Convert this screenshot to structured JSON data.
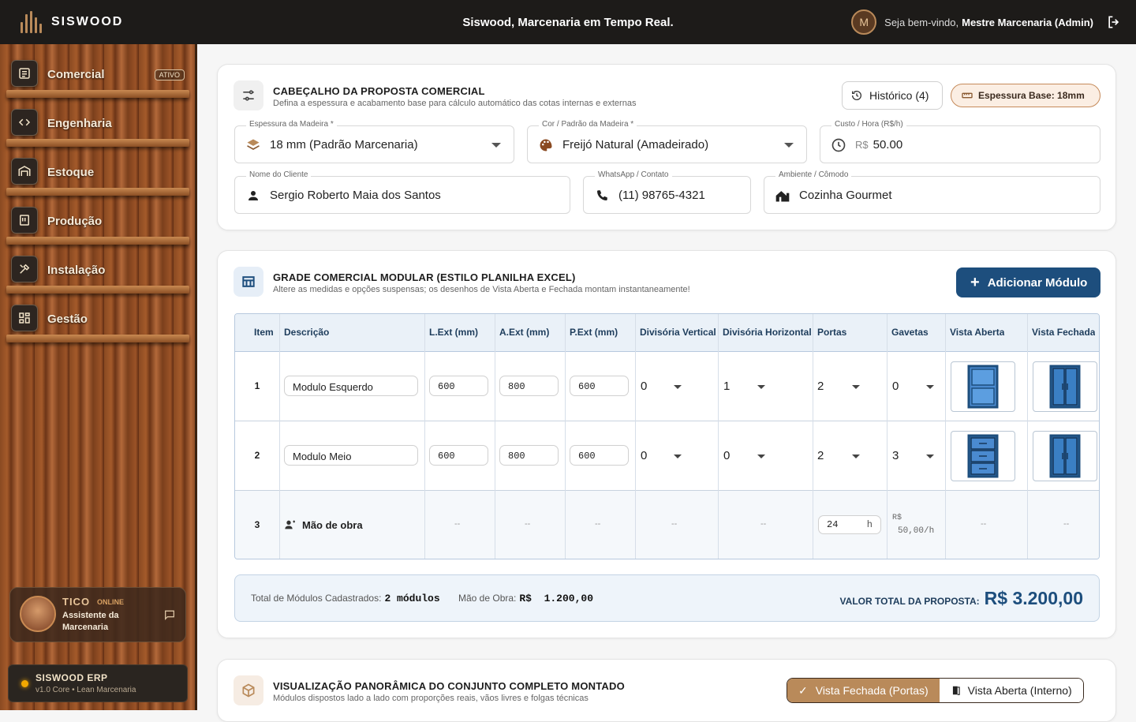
{
  "app": {
    "brand": "SISWOOD",
    "header_title": "Siswood, Marcenaria em Tempo Real.",
    "user_initial": "M",
    "welcome_prefix": "Seja bem-vindo,",
    "user_name": "Mestre Marcenaria (Admin)"
  },
  "sidebar": {
    "items": [
      {
        "label": "Comercial",
        "icon": "store-icon",
        "badge": "ATIVO"
      },
      {
        "label": "Engenharia",
        "icon": "code-icon"
      },
      {
        "label": "Estoque",
        "icon": "warehouse-icon"
      },
      {
        "label": "Produção",
        "icon": "production-icon"
      },
      {
        "label": "Instalação",
        "icon": "install-icon"
      },
      {
        "label": "Gestão",
        "icon": "dashboard-icon"
      }
    ],
    "assistant": {
      "name": "TICO",
      "status": "ONLINE",
      "subtitle": "Assistente da Marcenaria"
    },
    "erp": {
      "name": "SISWOOD ERP",
      "version": "v1.0 Core • Lean Marcenaria"
    }
  },
  "header_card": {
    "title": "CABEÇALHO DA PROPOSTA COMERCIAL",
    "subtitle": "Defina a espessura e acabamento base para cálculo automático das cotas internas e externas",
    "history_label": "Histórico (4)",
    "thickness_badge": "Espessura Base: 18mm",
    "fields": {
      "espessura": {
        "label": "Espessura da Madeira *",
        "value": "18 mm (Padrão Marcenaria)"
      },
      "cor": {
        "label": "Cor / Padrão da Madeira *",
        "value": "Freijó Natural (Amadeirado)"
      },
      "custo": {
        "label": "Custo / Hora (R$/h)",
        "prefix": "R$",
        "value": "50.00"
      },
      "cliente": {
        "label": "Nome do Cliente",
        "value": "Sergio Roberto Maia dos Santos"
      },
      "whatsapp": {
        "label": "WhatsApp / Contato",
        "value": "(11) 98765-4321"
      },
      "ambiente": {
        "label": "Ambiente / Cômodo",
        "value": "Cozinha Gourmet"
      }
    }
  },
  "grid_card": {
    "title": "GRADE COMERCIAL MODULAR (ESTILO PLANILHA EXCEL)",
    "subtitle": "Altere as medidas e opções suspensas; os desenhos de Vista Aberta e Fechada montam instantaneamente!",
    "add_button": "Adicionar Módulo",
    "columns": [
      "Item",
      "Descrição",
      "L.Ext (mm)",
      "A.Ext (mm)",
      "P.Ext (mm)",
      "Divisória Vertical",
      "Divisória Horizontal",
      "Portas",
      "Gavetas",
      "Vista Aberta",
      "Vista Fechada"
    ],
    "rows": [
      {
        "item": "1",
        "descricao": "Modulo Esquerdo",
        "l": "600",
        "a": "800",
        "p": "600",
        "div_v": "0",
        "div_h": "1",
        "portas": "2",
        "gavetas": "0"
      },
      {
        "item": "2",
        "descricao": "Modulo Meio",
        "l": "600",
        "a": "800",
        "p": "600",
        "div_v": "0",
        "div_h": "0",
        "portas": "2",
        "gavetas": "3"
      }
    ],
    "labor": {
      "item": "3",
      "label": "Mão de obra",
      "hours": "24",
      "hours_unit": "h",
      "rate_line1": "R$",
      "rate_line2": "50,00/h",
      "dash": "--"
    },
    "summary": {
      "modules_label": "Total de Módulos Cadastrados:",
      "modules_value": "2 módulos",
      "labor_label": "Mão de Obra:",
      "labor_value": "R$  1.200,00",
      "total_label": "VALOR TOTAL DA PROPOSTA:",
      "total_value": "R$ 3.200,00"
    }
  },
  "panorama_card": {
    "title": "VISUALIZAÇÃO PANORÂMICA DO CONJUNTO COMPLETO MONTADO",
    "subtitle": "Módulos dispostos lado a lado com proporções reais, vãos livres e folgas técnicas",
    "toggle_closed": "Vista Fechada (Portas)",
    "toggle_open": "Vista Aberta (Interno)"
  },
  "colors": {
    "accent": "#1d4e7d",
    "wood": "#b98a5a",
    "topbar": "#1d1b19"
  }
}
